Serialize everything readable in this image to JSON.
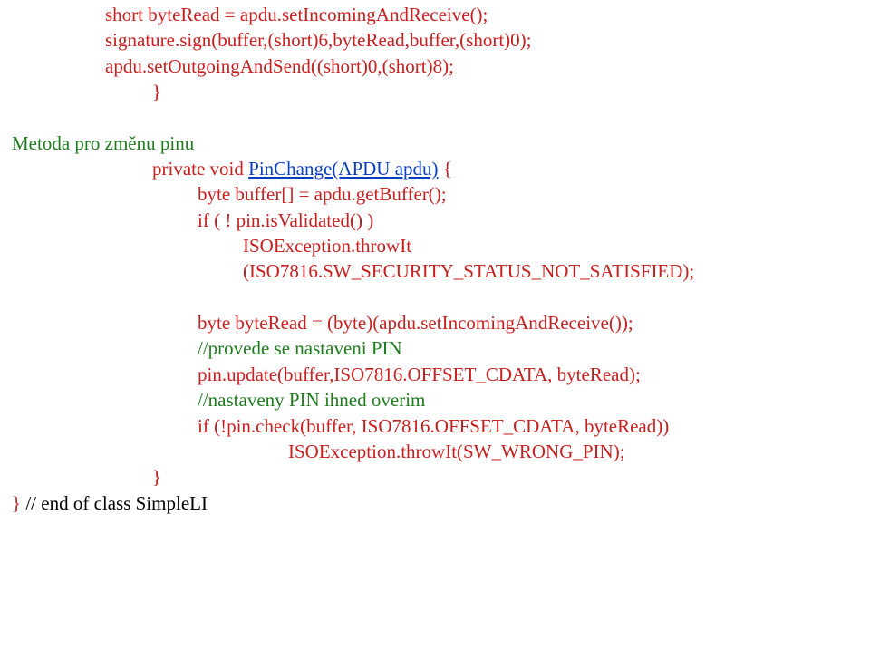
{
  "l1a": "short byteRead = apdu.setIncomingAndReceive();",
  "l2a": "signature.sign(buffer,(short)6,byteRead,buffer,(short)0);",
  "l3a": "apdu.setOutgoingAndSend((short)0,(short)8);",
  "l4a": "}",
  "l5blank": " ",
  "l6a": "Metoda pro změnu pinu",
  "l7a": "private void",
  "l7b": "PinChange(APDU apdu)",
  "l7c": " {",
  "l8a": "byte buffer[] = apdu.getBuffer();",
  "l9a": "if ( ! pin.isValidated() )",
  "l10a": "ISOException.throwIt",
  "l11a": "(ISO7816.SW_SECURITY_STATUS_NOT_SATISFIED);",
  "l12blank": " ",
  "l13a": "byte byteRead = (byte)(apdu.setIncomingAndReceive());",
  "l14a": "//provede se nastaveni PIN",
  "l15a": "pin.update(buffer,ISO7816.OFFSET_CDATA, byteRead);",
  "l16a": "//nastaveny PIN ihned overim",
  "l17a": "if (!pin.check(buffer, ISO7816.OFFSET_CDATA, byteRead))",
  "l18a": "ISOException.throwIt(SW_WRONG_PIN);",
  "l19a": "}",
  "l20a": "}",
  "l20b": " // end of class SimpleLI"
}
